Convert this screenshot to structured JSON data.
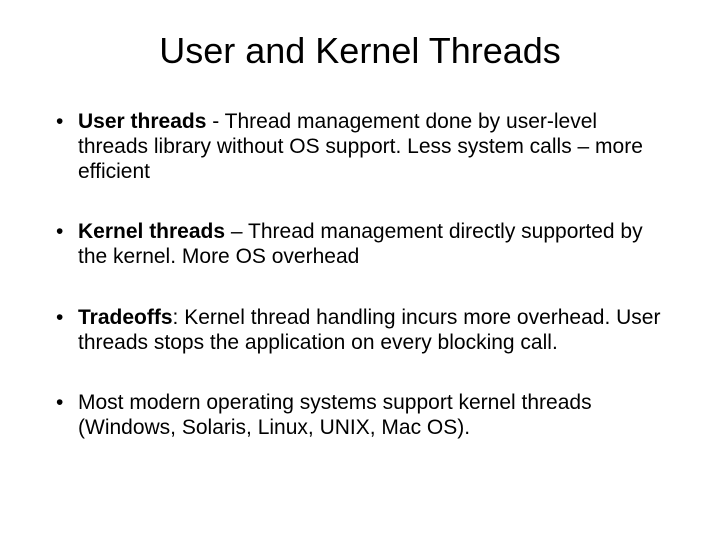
{
  "title": "User and Kernel Threads",
  "bullets": [
    {
      "bold": "User threads",
      "rest": " - Thread management done by user-level threads library without OS support. Less system calls – more efficient"
    },
    {
      "bold": "Kernel threads",
      "rest": " – Thread management directly supported by the kernel. More OS overhead"
    },
    {
      "bold": "Tradeoffs",
      "rest": ": Kernel thread handling incurs more overhead. User threads stops the application on every blocking call."
    },
    {
      "bold": "",
      "rest": "Most modern operating systems support kernel threads (Windows, Solaris, Linux, UNIX, Mac OS)."
    }
  ]
}
